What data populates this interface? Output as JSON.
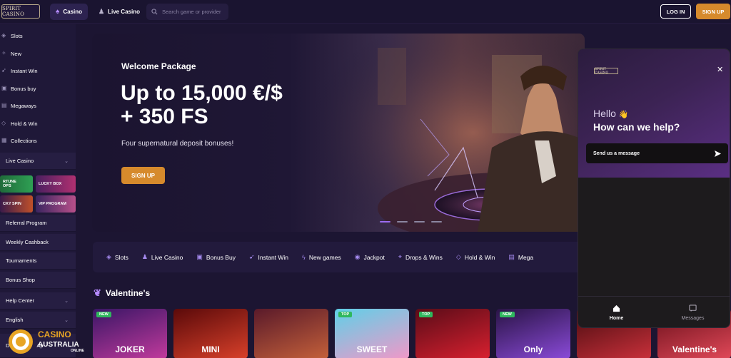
{
  "header": {
    "logo_text": "SPIRIT CASINO",
    "tabs": [
      {
        "label": "Casino",
        "icon": "spade-icon"
      },
      {
        "label": "Live Casino",
        "icon": "dealer-icon"
      }
    ],
    "search_placeholder": "Search game or provider",
    "login_label": "LOG IN",
    "signup_label": "SIGN UP"
  },
  "sidebar": {
    "items": [
      "Slots",
      "New",
      "Instant Win",
      "Bonus buy",
      "Megaways",
      "Hold & Win",
      "Collections"
    ],
    "live_casino": "Live Casino",
    "tiles": [
      "RTUNE\nOPS",
      "LUCKY BOX",
      "CKY SPIN",
      "VIP PROGRAM"
    ],
    "links": [
      "Referral Program",
      "Weekly Cashback",
      "Tournaments",
      "Bonus Shop",
      "Help Center",
      "English"
    ],
    "bottom_partial": "D",
    "bottom_partial_2": "Ap"
  },
  "hero": {
    "subtitle": "Welcome Package",
    "title_line1": "Up to 15,000 €/$",
    "title_line2": "+ 350 FS",
    "description": "Four supernatural deposit bonuses!",
    "cta": "SIGN UP",
    "slide_count": 4,
    "active_slide": 1
  },
  "categories": [
    {
      "label": "Slots",
      "icon": "slot-icon"
    },
    {
      "label": "Live Casino",
      "icon": "dealer-icon"
    },
    {
      "label": "Bonus Buy",
      "icon": "gift-icon"
    },
    {
      "label": "Instant Win",
      "icon": "rocket-icon"
    },
    {
      "label": "New games",
      "icon": "bolt-icon"
    },
    {
      "label": "Jackpot",
      "icon": "jackpot-icon"
    },
    {
      "label": "Drops & Wins",
      "icon": "drops-icon"
    },
    {
      "label": "Hold & Win",
      "icon": "hold-icon"
    },
    {
      "label": "Mega",
      "icon": "megaways-icon"
    }
  ],
  "section": {
    "title": "Valentine's",
    "icon": "heart-icon"
  },
  "games": [
    {
      "badge": "NEW",
      "text": "JOKER",
      "colors": [
        "#3a1666",
        "#c13a9c"
      ]
    },
    {
      "badge": "",
      "text": "MINI",
      "colors": [
        "#5b0a0a",
        "#d8402a"
      ]
    },
    {
      "badge": "",
      "text": "",
      "colors": [
        "#5a1a2a",
        "#c4603a"
      ]
    },
    {
      "badge": "TOP",
      "text": "SWEET",
      "colors": [
        "#5fd0e8",
        "#f098c8"
      ]
    },
    {
      "badge": "TOP",
      "text": "",
      "colors": [
        "#5a0c18",
        "#d8202f"
      ]
    },
    {
      "badge": "NEW",
      "text": "Only",
      "colors": [
        "#2a1446",
        "#8a4ad8"
      ]
    },
    {
      "badge": "",
      "text": "",
      "colors": [
        "#4a0c10",
        "#c8303a"
      ]
    },
    {
      "badge": "",
      "text": "Valentine's",
      "colors": [
        "#6a0f1a",
        "#e04858"
      ]
    }
  ],
  "chat": {
    "logo_text": "SPIRIT CASINO",
    "greeting": "Hello",
    "wave": "👋",
    "question": "How can we help?",
    "send_label": "Send us a message",
    "tabs": [
      {
        "label": "Home",
        "icon": "home-icon"
      },
      {
        "label": "Messages",
        "icon": "messages-icon"
      }
    ]
  },
  "watermark": {
    "line1": "CASINO",
    "line2": "AUSTRALIA",
    "line3": "ONLINE"
  }
}
